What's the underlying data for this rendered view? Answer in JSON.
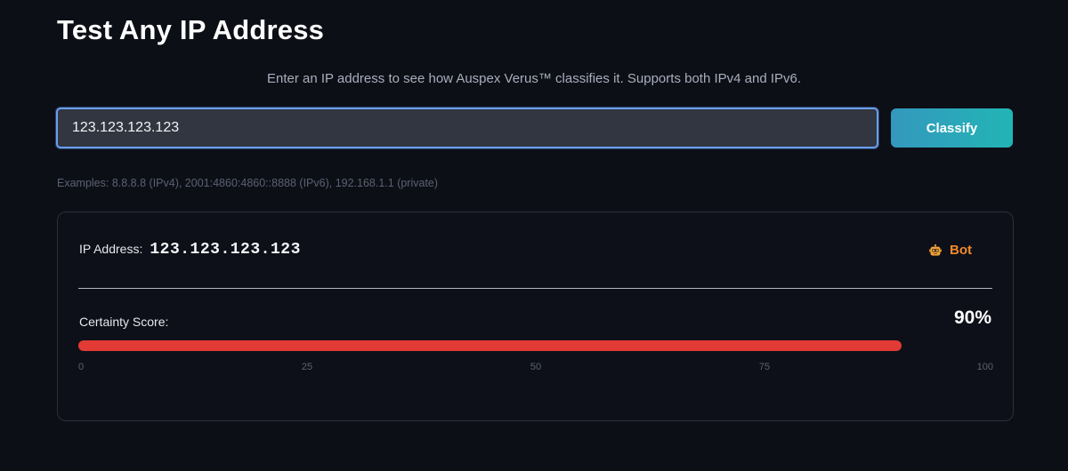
{
  "header": {
    "title": "Test Any IP Address",
    "subtitle": "Enter an IP address to see how Auspex Verus™ classifies it. Supports both IPv4 and IPv6."
  },
  "form": {
    "ip_value": "123.123.123.123",
    "classify_label": "Classify",
    "examples": "Examples: 8.8.8.8 (IPv4), 2001:4860:4860::8888 (IPv6), 192.168.1.1 (private)"
  },
  "result": {
    "ip_label": "IP Address:",
    "ip_value": "123.123.123.123",
    "classification": "Bot",
    "classification_icon": "robot-icon",
    "classification_color": "#f0892c",
    "certainty_label": "Certainty Score:",
    "certainty_text": "90%",
    "certainty_fraction": 0.9,
    "bar_color": "#e23a35",
    "scale_ticks": [
      "0",
      "25",
      "50",
      "75",
      "100"
    ]
  },
  "colors": {
    "background": "#0d0f17",
    "accent_gradient_start": "#3498be",
    "accent_gradient_end": "#22b5b5",
    "input_focus_border": "#6a9ff0"
  }
}
